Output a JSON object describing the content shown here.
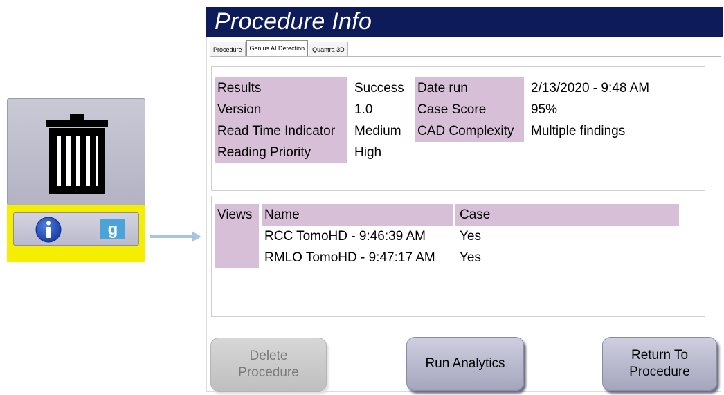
{
  "callout": {
    "icons": [
      "trash-icon",
      "info-icon",
      "genius-g-icon",
      "arrow-right-icon"
    ],
    "g_letter": "g"
  },
  "header": {
    "title": "Procedure Info"
  },
  "tabs": [
    {
      "label": "Procedure",
      "active": false
    },
    {
      "label": "Genius AI Detection",
      "active": true
    },
    {
      "label": "Quantra 3D",
      "active": false
    }
  ],
  "results": {
    "results_label": "Results",
    "results_value": "Success",
    "version_label": "Version",
    "version_value": "1.0",
    "read_time_label": "Read Time Indicator",
    "read_time_value": "Medium",
    "priority_label": "Reading Priority",
    "priority_value": "High",
    "date_label": "Date run",
    "date_value": "2/13/2020 - 9:48 AM",
    "score_label": "Case Score",
    "score_value": "95%",
    "complexity_label": "CAD Complexity",
    "complexity_value": "Multiple findings"
  },
  "views": {
    "label": "Views",
    "columns": [
      "Name",
      "Case"
    ],
    "rows": [
      {
        "name": "RCC TomoHD - 9:46:39 AM",
        "case": "Yes"
      },
      {
        "name": "RMLO TomoHD - 9:47:17 AM",
        "case": "Yes"
      }
    ]
  },
  "buttons": {
    "delete": "Delete Procedure",
    "run": "Run Analytics",
    "return": "Return To Procedure"
  },
  "colors": {
    "title_bg": "#0e1b5a",
    "label_bg": "#d8bfd8",
    "highlight": "#f5ee00"
  }
}
